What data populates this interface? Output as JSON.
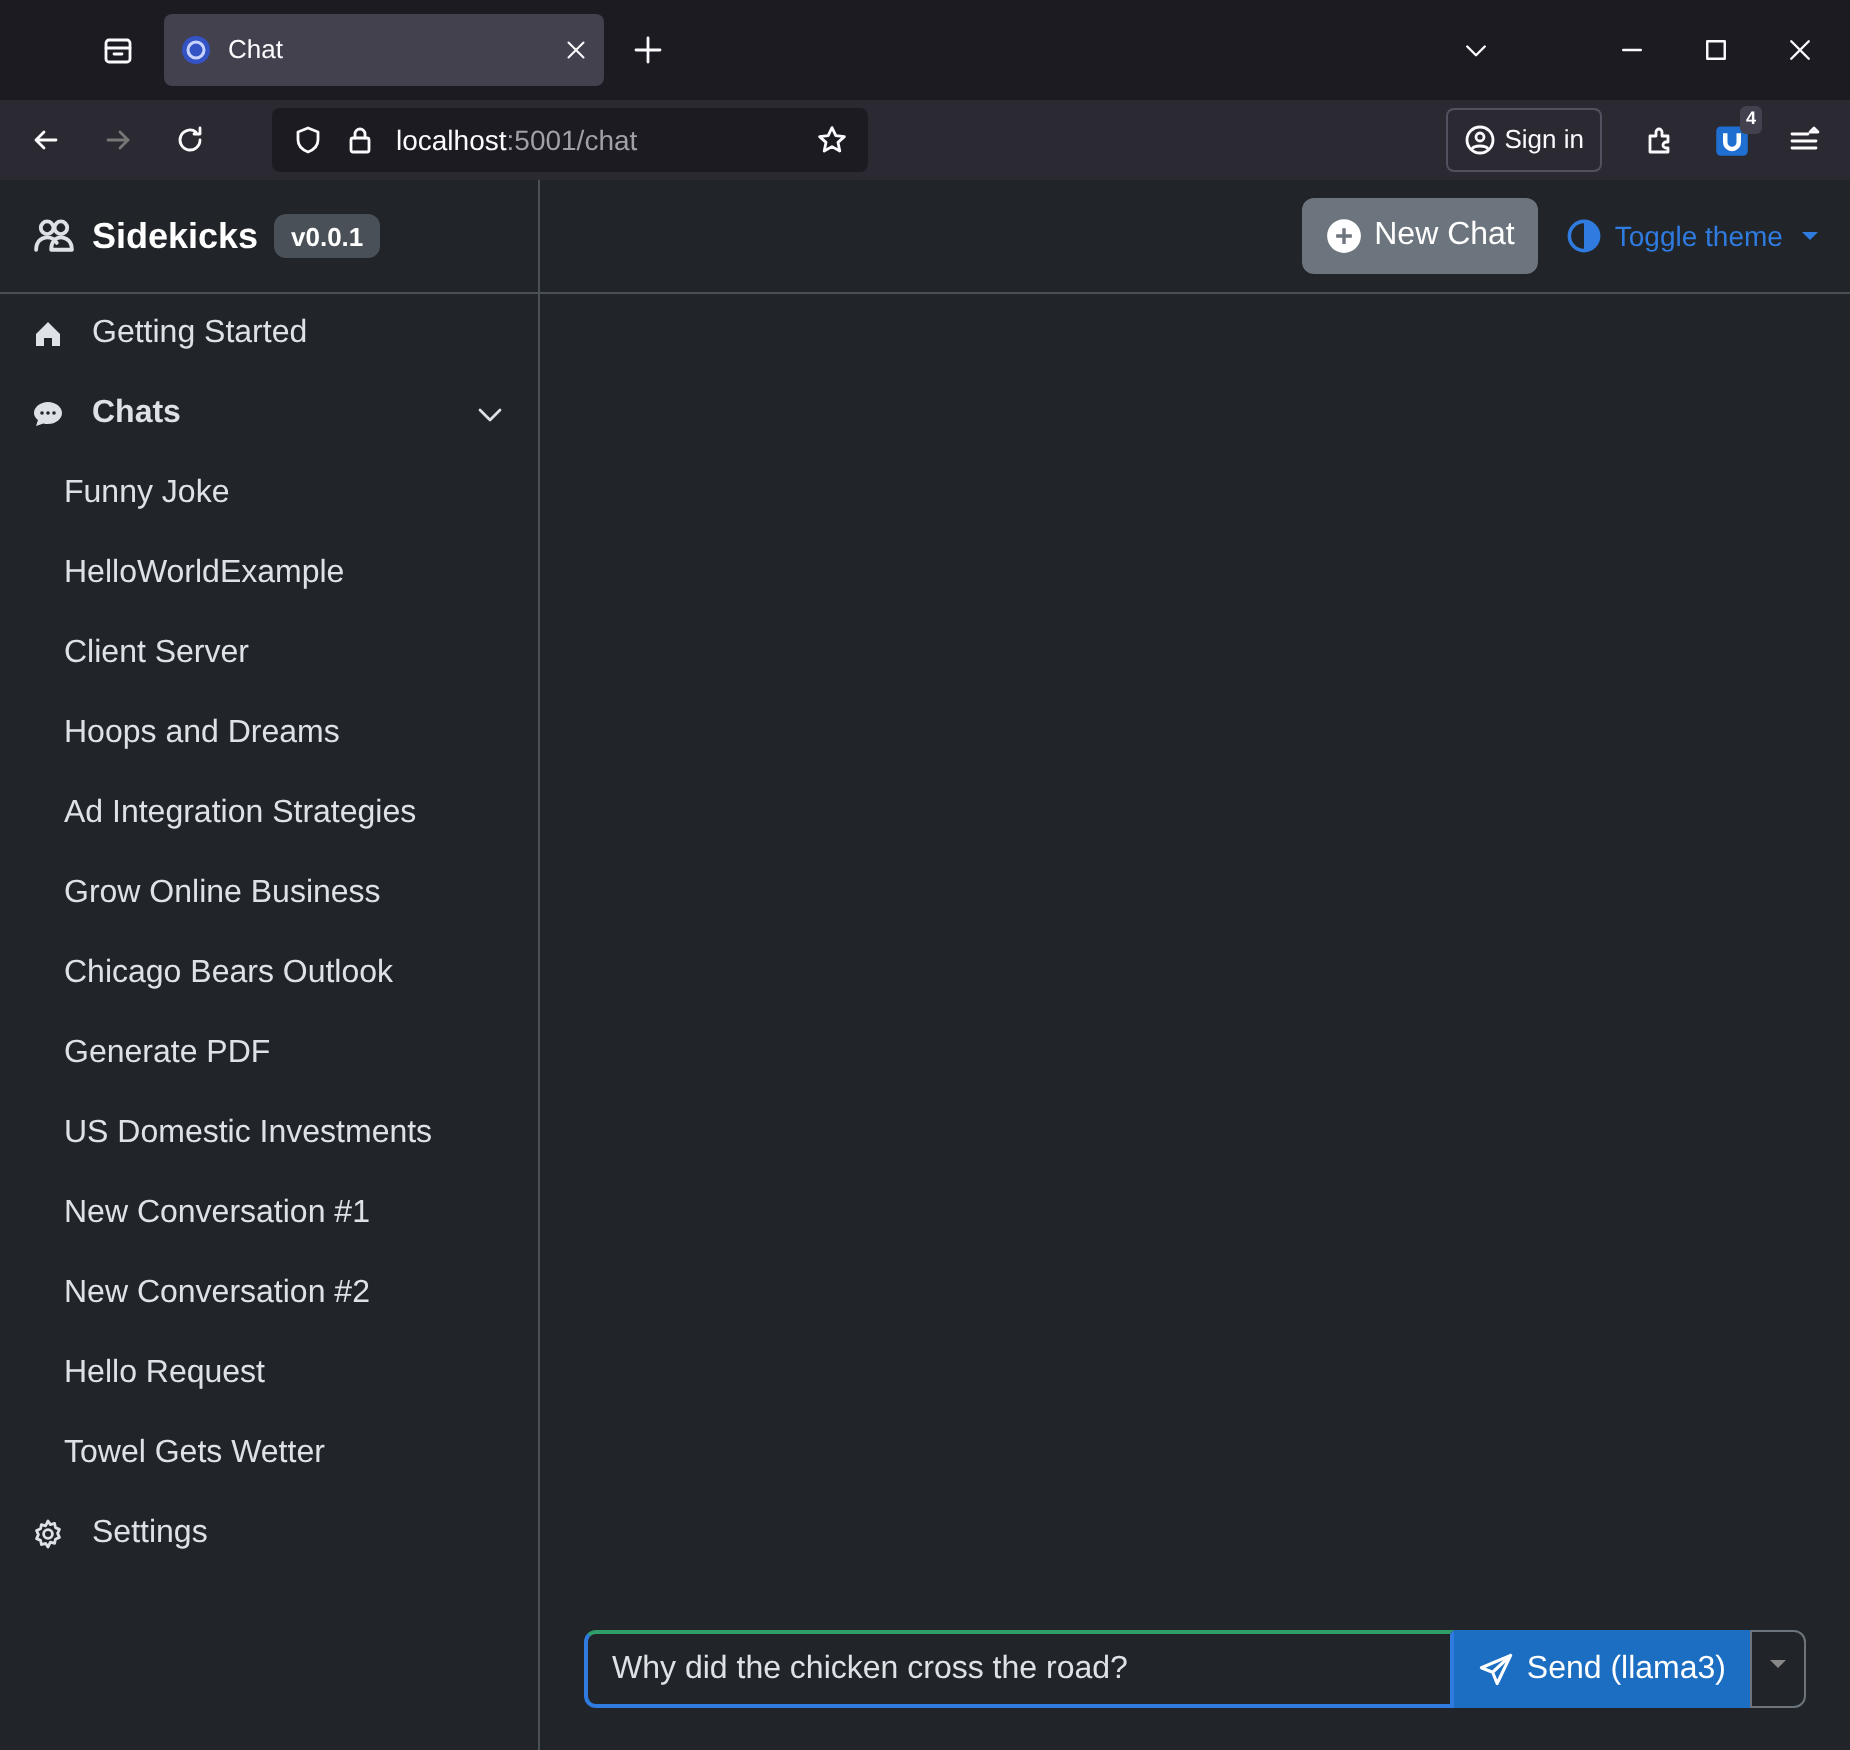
{
  "browser": {
    "tab_title": "Chat",
    "url_host": "localhost",
    "url_path": ":5001/chat",
    "sign_in": "Sign in",
    "extension_badge": "4"
  },
  "sidebar": {
    "brand": "Sidekicks",
    "version": "v0.0.1",
    "items": [
      {
        "kind": "link",
        "label": "Getting Started"
      },
      {
        "kind": "group",
        "label": "Chats",
        "expanded": true,
        "children": [
          {
            "label": "Funny Joke"
          },
          {
            "label": "HelloWorldExample"
          },
          {
            "label": "Client Server"
          },
          {
            "label": "Hoops and Dreams"
          },
          {
            "label": "Ad Integration Strategies"
          },
          {
            "label": "Grow Online Business"
          },
          {
            "label": "Chicago Bears Outlook"
          },
          {
            "label": "Generate PDF"
          },
          {
            "label": "US Domestic Investments"
          },
          {
            "label": "New Conversation #1"
          },
          {
            "label": "New Conversation #2"
          },
          {
            "label": "Hello Request"
          },
          {
            "label": "Towel Gets Wetter"
          }
        ]
      },
      {
        "kind": "link",
        "label": "Settings"
      }
    ]
  },
  "header": {
    "new_chat": "New Chat",
    "toggle_theme": "Toggle theme"
  },
  "composer": {
    "value": "Why did the chicken cross the road?",
    "send": "Send (llama3)"
  }
}
